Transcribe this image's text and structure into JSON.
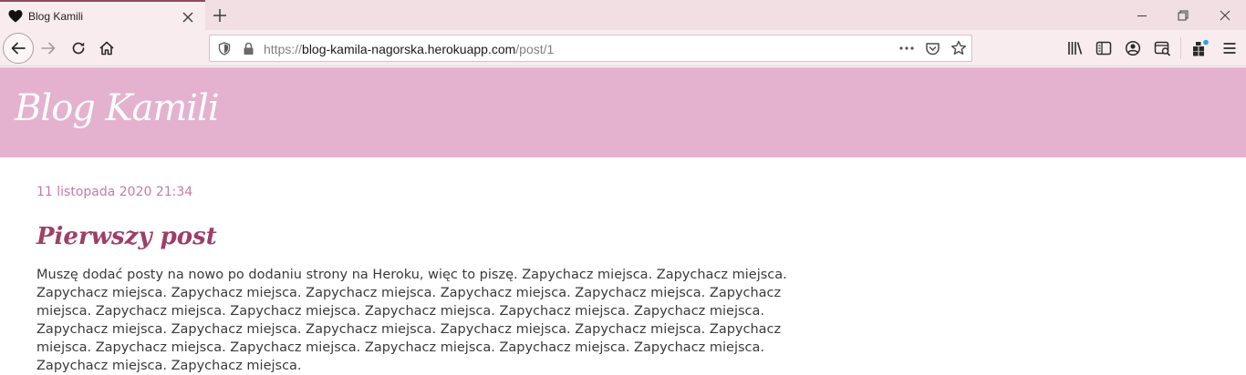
{
  "browser": {
    "tab": {
      "title": "Blog Kamili"
    },
    "url": {
      "scheme": "https://",
      "host": "blog-kamila-nagorska.herokuapp.com",
      "path": "/post/1"
    }
  },
  "site": {
    "title": "Blog Kamili"
  },
  "post": {
    "date": "11 listopada 2020 21:34",
    "title": "Pierwszy post",
    "body": "Muszę dodać posty na nowo po dodaniu strony na Heroku, więc to piszę. Zapychacz miejsca. Zapychacz miejsca. Zapychacz miejsca. Zapychacz miejsca. Zapychacz miejsca. Zapychacz miejsca. Zapychacz miejsca. Zapychacz miejsca. Zapychacz miejsca. Zapychacz miejsca. Zapychacz miejsca. Zapychacz miejsca. Zapychacz miejsca. Zapychacz miejsca. Zapychacz miejsca. Zapychacz miejsca. Zapychacz miejsca. Zapychacz miejsca. Zapychacz miejsca. Zapychacz miejsca. Zapychacz miejsca. Zapychacz miejsca. Zapychacz miejsca. Zapychacz miejsca. Zapychacz miejsca. Zapychacz miejsca."
  },
  "colors": {
    "header": "#e4b2ce",
    "accent": "#9c3f69",
    "date": "#c77aa6",
    "toolbar": "#f9ecee"
  },
  "icons": [
    "heart-icon",
    "close-icon",
    "plus-icon",
    "back-arrow-icon",
    "forward-arrow-icon",
    "reload-icon",
    "home-icon",
    "shield-icon",
    "lock-icon",
    "more-icon",
    "pocket-icon",
    "star-icon",
    "library-icon",
    "sidebar-icon",
    "account-icon",
    "screenshot-icon",
    "extensions-icon",
    "menu-icon"
  ]
}
